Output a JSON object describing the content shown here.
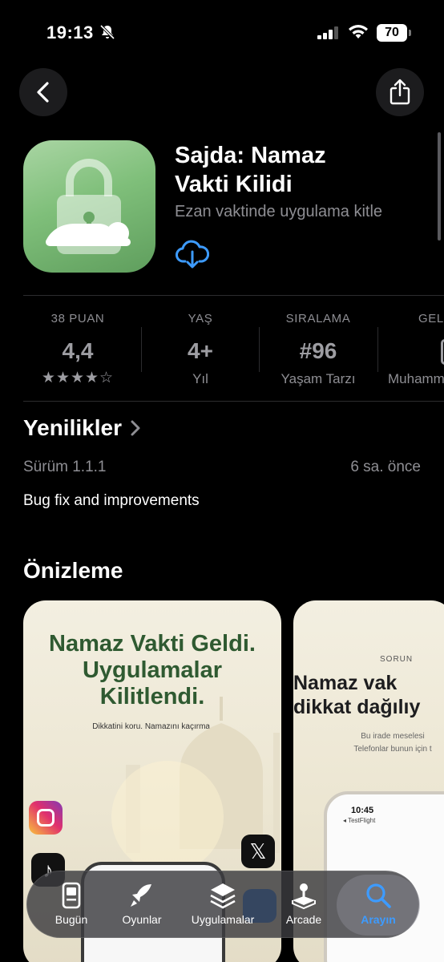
{
  "status_bar": {
    "time": "19:13",
    "battery": "70"
  },
  "app": {
    "title_line1": "Sajda: Namaz",
    "title_line2": "Vakti Kilidi",
    "subtitle": "Ezan vaktinde uygulama kitle"
  },
  "stats": [
    {
      "label": "38 PUAN",
      "value": "4,4",
      "stars": "★★★★☆"
    },
    {
      "label": "YAŞ",
      "value": "4+",
      "sub": "Yıl"
    },
    {
      "label": "SIRALAMA",
      "value": "#96",
      "sub": "Yaşam Tarzı"
    },
    {
      "label": "GEL",
      "sub": "Muhamm"
    }
  ],
  "whats_new": {
    "title": "Yenilikler",
    "version": "Sürüm 1.1.1",
    "ago": "6 sa. önce",
    "notes": "Bug fix and improvements"
  },
  "preview": {
    "title": "Önizleme",
    "shot1_line1": "Namaz Vakti Geldi.",
    "shot1_line2": "Uygulamalar",
    "shot1_line3": "Kilitlendi.",
    "shot1_small": "Dikkatini koru. Namazını kaçırma.",
    "shot2_kicker": "SORUN",
    "shot2_line1": "Namaz vak",
    "shot2_line2": "dikkat dağılıy",
    "shot2_body1": "Bu irade meselesi",
    "shot2_body2": "Telefonlar bunun için t",
    "phone_time": "10:45",
    "phone_app": "◂ TestFlight"
  },
  "tabs": [
    {
      "label": "Bugün",
      "icon": "today-icon"
    },
    {
      "label": "Oyunlar",
      "icon": "rocket-icon"
    },
    {
      "label": "Uygulamalar",
      "icon": "apps-stack-icon"
    },
    {
      "label": "Arcade",
      "icon": "joystick-icon"
    },
    {
      "label": "Arayın",
      "icon": "search-icon",
      "active": true
    }
  ],
  "colors": {
    "accent": "#3d9bff",
    "icon_green": "#7fbf7a",
    "preview_heading": "#2f5a31",
    "secondary_text": "#8e8e93"
  }
}
